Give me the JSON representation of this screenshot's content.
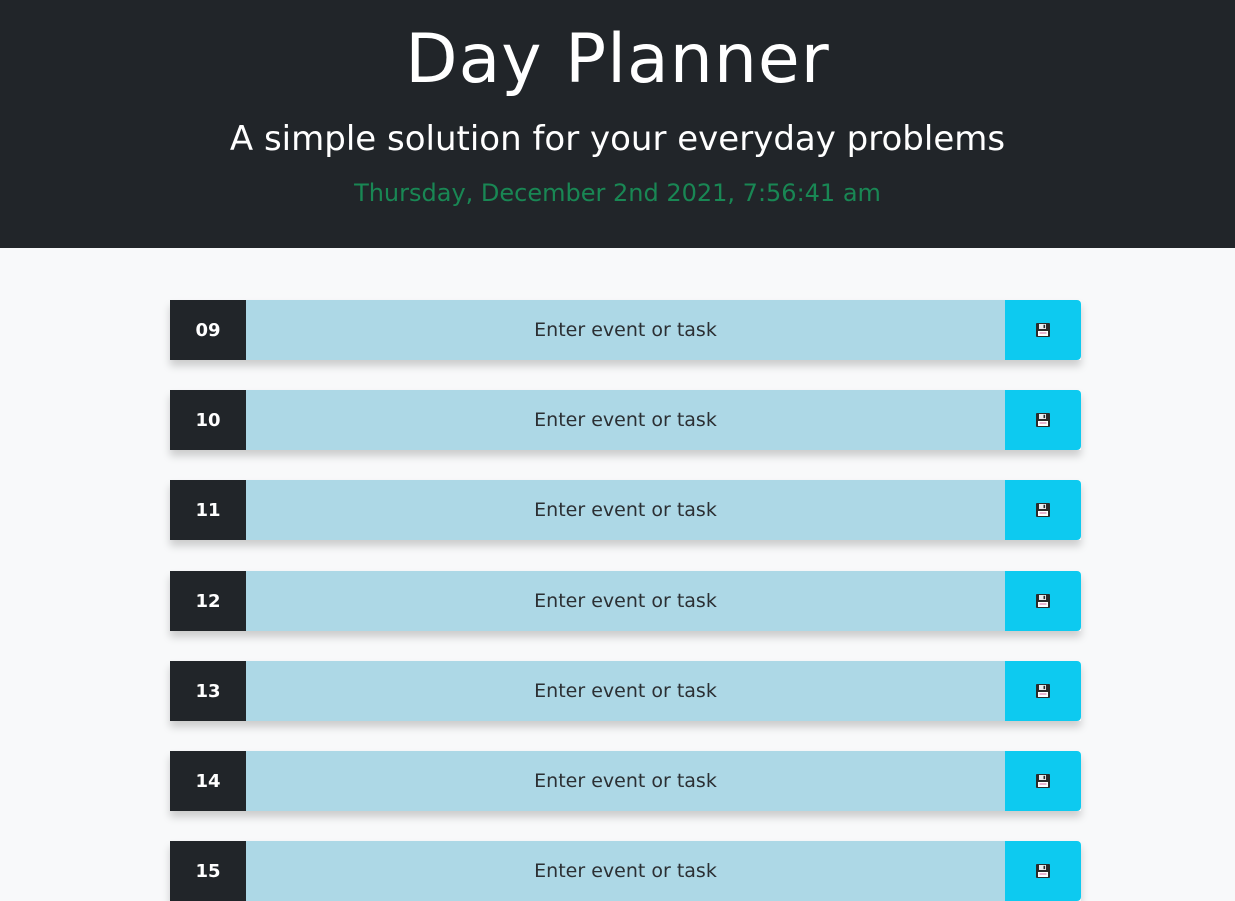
{
  "header": {
    "title": "Day Planner",
    "subtitle": "A simple solution for your everyday problems",
    "datetime": "Thursday, December 2nd 2021, 7:56:41 am"
  },
  "rows": [
    {
      "hour": "09",
      "placeholder": "Enter event or task",
      "save_icon": "floppy-disk-icon"
    },
    {
      "hour": "10",
      "placeholder": "Enter event or task",
      "save_icon": "floppy-disk-icon"
    },
    {
      "hour": "11",
      "placeholder": "Enter event or task",
      "save_icon": "floppy-disk-icon"
    },
    {
      "hour": "12",
      "placeholder": "Enter event or task",
      "save_icon": "floppy-disk-icon"
    },
    {
      "hour": "13",
      "placeholder": "Enter event or task",
      "save_icon": "floppy-disk-icon"
    },
    {
      "hour": "14",
      "placeholder": "Enter event or task",
      "save_icon": "floppy-disk-icon"
    },
    {
      "hour": "15",
      "placeholder": "Enter event or task",
      "save_icon": "floppy-disk-icon"
    }
  ],
  "colors": {
    "header_bg": "#212529",
    "datetime": "#198754",
    "hour_bg": "#212529",
    "task_bg": "#add8e6",
    "save_bg": "#0dcaf0"
  }
}
